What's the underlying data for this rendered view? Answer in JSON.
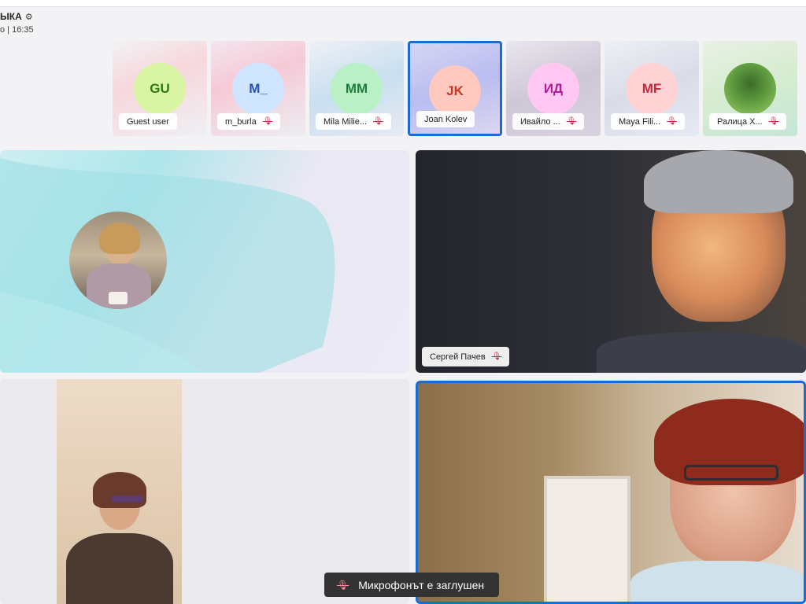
{
  "header": {
    "title": "ЫКА",
    "settings_icon": "⚙",
    "time": "о | 16:35"
  },
  "gallery": [
    {
      "initials": "GU",
      "name": "Guest user",
      "muted": false,
      "active": false,
      "avatar_bg": "#d9f5a3",
      "initials_color": "#2f7a14"
    },
    {
      "initials": "M_",
      "name": "m_burla",
      "muted": true,
      "active": false,
      "avatar_bg": "#cfe4ff",
      "initials_color": "#2551b8"
    },
    {
      "initials": "MM",
      "name": "Mila Milie...",
      "muted": true,
      "active": false,
      "avatar_bg": "#b9f0c6",
      "initials_color": "#1e7d3a"
    },
    {
      "initials": "JK",
      "name": "Joan Kolev",
      "muted": false,
      "active": true,
      "avatar_bg": "#ffc9c0",
      "initials_color": "#c5381f"
    },
    {
      "initials": "ИД",
      "name": "Ивайло ...",
      "muted": true,
      "active": false,
      "avatar_bg": "#ffc7f2",
      "initials_color": "#b21c9a"
    },
    {
      "initials": "MF",
      "name": "Maya Fili...",
      "muted": true,
      "active": false,
      "avatar_bg": "#ffd3d3",
      "initials_color": "#c2273a"
    },
    {
      "initials": "",
      "name": "Ралица Х...",
      "muted": true,
      "active": false,
      "avatar_bg": "#9ccf6a",
      "initials_color": "#333333"
    }
  ],
  "main": {
    "tile_name_sergey": "Сергей Пачев"
  },
  "toast": {
    "text": "Микрофонът е заглушен"
  },
  "icons": {
    "mic_off": "🎙"
  }
}
